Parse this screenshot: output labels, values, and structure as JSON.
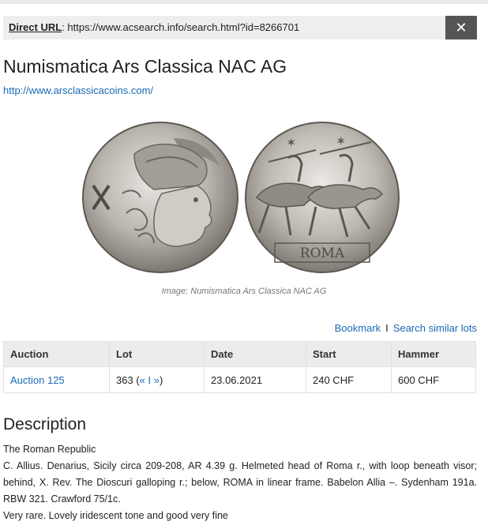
{
  "url_bar": {
    "label": "Direct URL",
    "url": "https://www.acsearch.info/search.html?id=8266701",
    "close_icon": "close-icon"
  },
  "page": {
    "title": "Numismatica Ars Classica NAC AG",
    "site_url": "http://www.arsclassicacoins.com/"
  },
  "image": {
    "caption": "Image: Numismatica Ars Classica NAC AG",
    "obverse_legend": "X",
    "reverse_legend": "ROMA"
  },
  "actions": {
    "bookmark": "Bookmark",
    "separator": "I",
    "search_similar": "Search similar lots"
  },
  "table": {
    "headers": [
      "Auction",
      "Lot",
      "Date",
      "Start",
      "Hammer"
    ],
    "row": {
      "auction": "Auction 125",
      "lot": "363",
      "prev": "«",
      "sep": "I",
      "next": "»",
      "date": "23.06.2021",
      "start": "240 CHF",
      "hammer": "600 CHF"
    }
  },
  "description": {
    "heading": "Description",
    "lines": [
      "The Roman Republic",
      "C. Allius. Denarius, Sicily circa 209-208, AR 4.39 g. Helmeted head of Roma r., with loop beneath visor; behind, X. Rev. The Dioscuri galloping r.; below, ROMA in linear frame. Babelon Allia –. Sydenham 191a. RBW 321. Crawford 75/1c.",
      "Very rare. Lovely iridescent tone and good very fine"
    ]
  },
  "colors": {
    "link": "#1a6bb7",
    "close_button": "#555555",
    "header_bg": "#ececec"
  }
}
